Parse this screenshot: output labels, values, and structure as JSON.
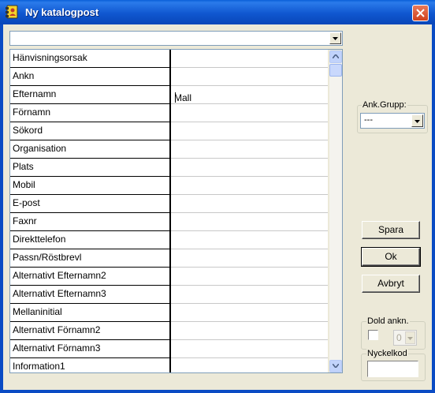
{
  "window": {
    "title": "Ny katalogpost"
  },
  "top_combo": {
    "value": ""
  },
  "fields": [
    {
      "label": "Hänvisningsorsak",
      "value": ""
    },
    {
      "label": "Ankn",
      "value": ""
    },
    {
      "label": "Efternamn",
      "value": "Mall"
    },
    {
      "label": "Förnamn",
      "value": ""
    },
    {
      "label": "Sökord",
      "value": ""
    },
    {
      "label": "Organisation",
      "value": ""
    },
    {
      "label": "Plats",
      "value": ""
    },
    {
      "label": "Mobil",
      "value": ""
    },
    {
      "label": "E-post",
      "value": ""
    },
    {
      "label": "Faxnr",
      "value": ""
    },
    {
      "label": "Direkttelefon",
      "value": ""
    },
    {
      "label": "Passn/Röstbrevl",
      "value": ""
    },
    {
      "label": "Alternativt Efternamn2",
      "value": ""
    },
    {
      "label": "Alternativt Efternamn3",
      "value": ""
    },
    {
      "label": "Mellaninitial",
      "value": ""
    },
    {
      "label": "Alternativt Förnamn2",
      "value": ""
    },
    {
      "label": "Alternativt Förnamn3",
      "value": ""
    },
    {
      "label": "Information1",
      "value": ""
    }
  ],
  "ank_grupp": {
    "label": "Ank.Grupp:",
    "value": "---"
  },
  "buttons": {
    "spara": "Spara",
    "ok": "Ok",
    "avbryt": "Avbryt"
  },
  "dold_ankn": {
    "label": "Dold ankn.",
    "checked": false,
    "value": "0"
  },
  "nyckelkod": {
    "label": "Nyckelkod",
    "value": ""
  },
  "colors": {
    "titlebar": "#0A5FD8",
    "close_button": "#D0401C",
    "dialog_background": "#ECE9D8"
  }
}
